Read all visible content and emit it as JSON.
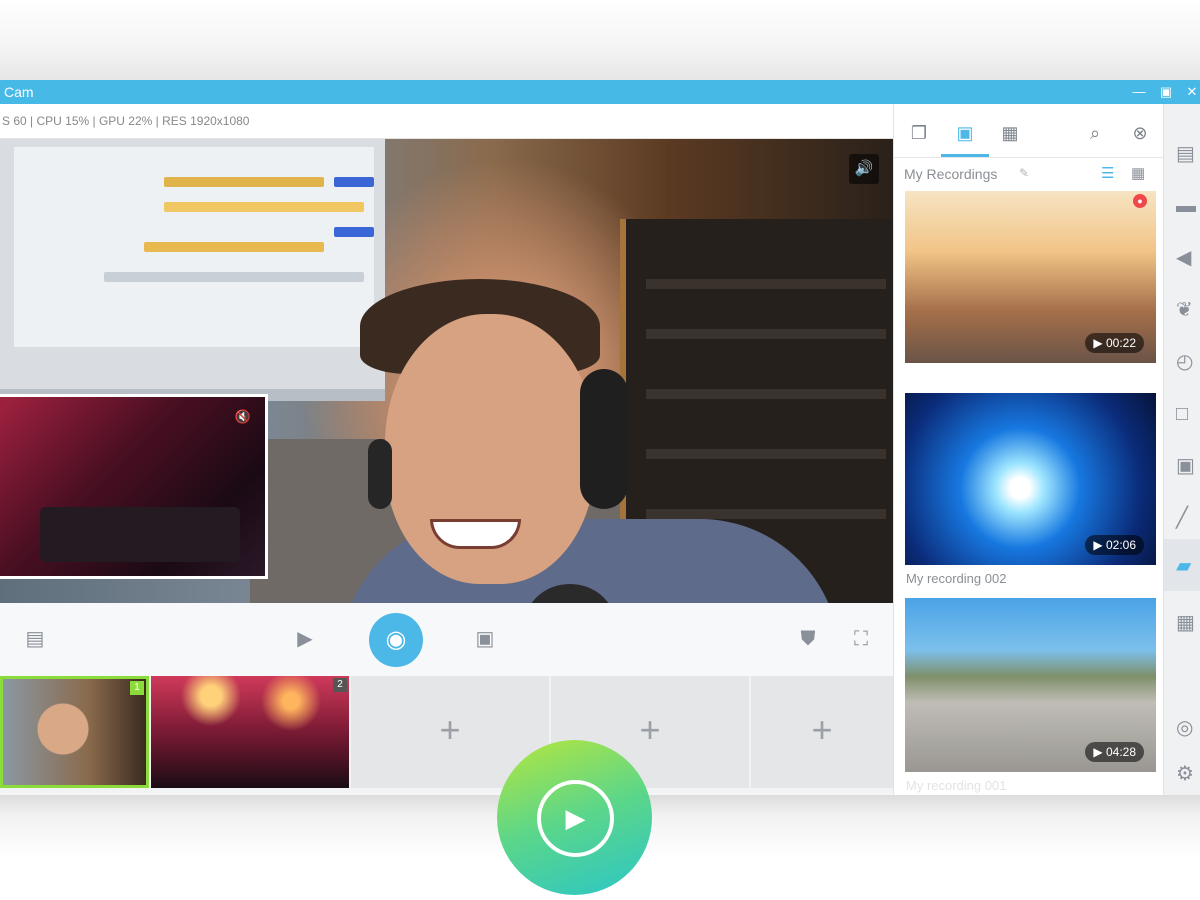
{
  "window": {
    "title": "Cam",
    "controls": [
      "minimize-icon",
      "restore-icon",
      "close-icon"
    ]
  },
  "stats": {
    "text": "S 60 | CPU 15% | GPU 22% | RES 1920x1080"
  },
  "preview": {
    "volume_icon": "volume-icon",
    "pip_mute_icon": "mute-icon"
  },
  "controls": {
    "left_icon": "layout-icon",
    "record_icon": "video-camera-icon",
    "live_icon": "broadcast-icon",
    "snapshot_icon": "camera-icon",
    "mask_icon": "mask-icon",
    "fullscreen_icon": "fullscreen-icon"
  },
  "scenes": [
    {
      "number": "1",
      "active": true
    },
    {
      "number": "2",
      "active": false
    },
    {
      "plus": "+"
    },
    {
      "plus": "+"
    },
    {
      "plus": "+"
    }
  ],
  "right_panel": {
    "tabs": [
      "scenes-icon",
      "recordings-icon",
      "gallery-icon"
    ],
    "search_icon": "search-icon",
    "close_icon": "close-circle-icon",
    "title": "My Recordings",
    "view_icons": [
      "list-view-icon",
      "grid-view-icon"
    ],
    "recordings": [
      {
        "duration": "00:22",
        "label": ""
      },
      {
        "duration": "02:06",
        "label": "My recording 002"
      },
      {
        "duration": "04:28",
        "label": "My recording 001"
      }
    ]
  },
  "far_sidebar": {
    "icons": [
      "layers-icon",
      "screen-icon",
      "audio-icon",
      "effects-icon",
      "timer-icon",
      "chat-icon",
      "monitor-icon",
      "magic-wand-icon",
      "media-icon",
      "grid-icon",
      "globe-icon",
      "settings-icon"
    ]
  },
  "overlay": {
    "play_icon": "play-icon"
  },
  "colors": {
    "accent": "#47b9e6",
    "play_gradient_start": "#b6e63d",
    "play_gradient_end": "#2bc6c7",
    "active_scene_border": "#8bdc3b"
  }
}
